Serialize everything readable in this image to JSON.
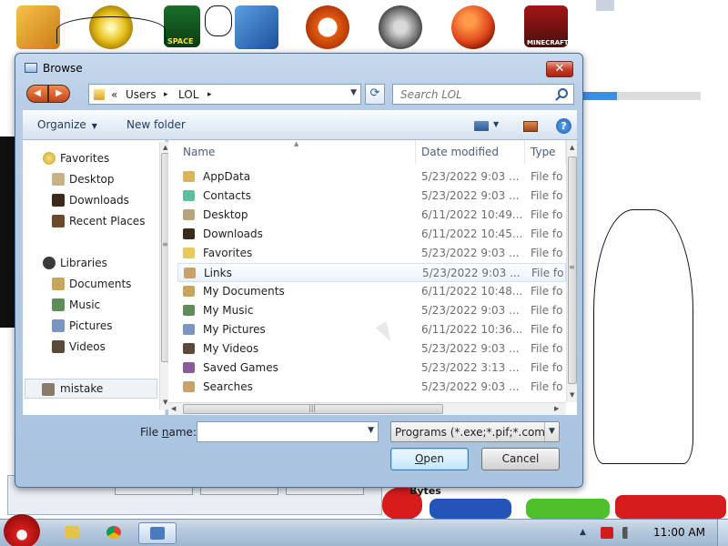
{
  "dialog": {
    "title": "Browse",
    "close_label": "✕",
    "address": {
      "crumbs": [
        "«",
        "Users",
        "LOL"
      ],
      "separator": "▸"
    },
    "search": {
      "placeholder": "Search LOL"
    },
    "toolbar": {
      "organize": "Organize",
      "new_folder": "New folder",
      "help": "?"
    },
    "nav": {
      "favorites_header": "Favorites",
      "favorites": [
        "Desktop",
        "Downloads",
        "Recent Places"
      ],
      "libraries_header": "Libraries",
      "libraries": [
        "Documents",
        "Music",
        "Pictures",
        "Videos"
      ],
      "extra": "mistake"
    },
    "columns": {
      "name": "Name",
      "date": "Date modified",
      "type": "Type"
    },
    "files": [
      {
        "name": "AppData",
        "date": "5/23/2022 9:03 ...",
        "type": "File fo",
        "icon": "folder-icon",
        "color": "#d9b45a"
      },
      {
        "name": "Contacts",
        "date": "5/23/2022 9:03 ...",
        "type": "File fo",
        "icon": "contacts-icon",
        "color": "#5fbf9a"
      },
      {
        "name": "Desktop",
        "date": "6/11/2022 10:49...",
        "type": "File fo",
        "icon": "desktop-icon",
        "color": "#b7a37c"
      },
      {
        "name": "Downloads",
        "date": "6/11/2022 10:45...",
        "type": "File fo",
        "icon": "downloads-icon",
        "color": "#3b2a1c"
      },
      {
        "name": "Favorites",
        "date": "5/23/2022 9:03 ...",
        "type": "File fo",
        "icon": "favorites-icon",
        "color": "#e9c85a"
      },
      {
        "name": "Links",
        "date": "5/23/2022 9:03 ...",
        "type": "File fo",
        "icon": "links-icon",
        "color": "#c9a26b"
      },
      {
        "name": "My Documents",
        "date": "6/11/2022 10:48...",
        "type": "File fo",
        "icon": "documents-icon",
        "color": "#c7a55a"
      },
      {
        "name": "My Music",
        "date": "5/23/2022 9:03 ...",
        "type": "File fo",
        "icon": "music-icon",
        "color": "#5e8d5a"
      },
      {
        "name": "My Pictures",
        "date": "6/11/2022 10:36...",
        "type": "File fo",
        "icon": "pictures-icon",
        "color": "#7b95c2"
      },
      {
        "name": "My Videos",
        "date": "5/23/2022 9:03 ...",
        "type": "File fo",
        "icon": "videos-icon",
        "color": "#5b4a3a"
      },
      {
        "name": "Saved Games",
        "date": "5/23/2022 3:13 ...",
        "type": "File fo",
        "icon": "saved-games-icon",
        "color": "#8a5a9a"
      },
      {
        "name": "Searches",
        "date": "5/23/2022 9:03 ...",
        "type": "File fo",
        "icon": "searches-icon",
        "color": "#c9a26b"
      }
    ],
    "filename": {
      "label_prefix": "File ",
      "label_accel": "n",
      "label_suffix": "ame:",
      "value": ""
    },
    "filter": "Programs (*.exe;*.pif;*.com;*.bat",
    "buttons": {
      "open_accel": "O",
      "open_rest": "pen",
      "cancel": "Cancel"
    }
  },
  "desktop": {
    "icon_labels": [
      "SPACE",
      "MINECRAFT"
    ],
    "progress_fraction": 0.29,
    "brand_bytes": "Bytes"
  },
  "taskbar": {
    "clock": "11:00 AM"
  },
  "colors": {
    "accent": "#3c7fb1",
    "close": "#c5402c",
    "start": "#d81e1e"
  }
}
